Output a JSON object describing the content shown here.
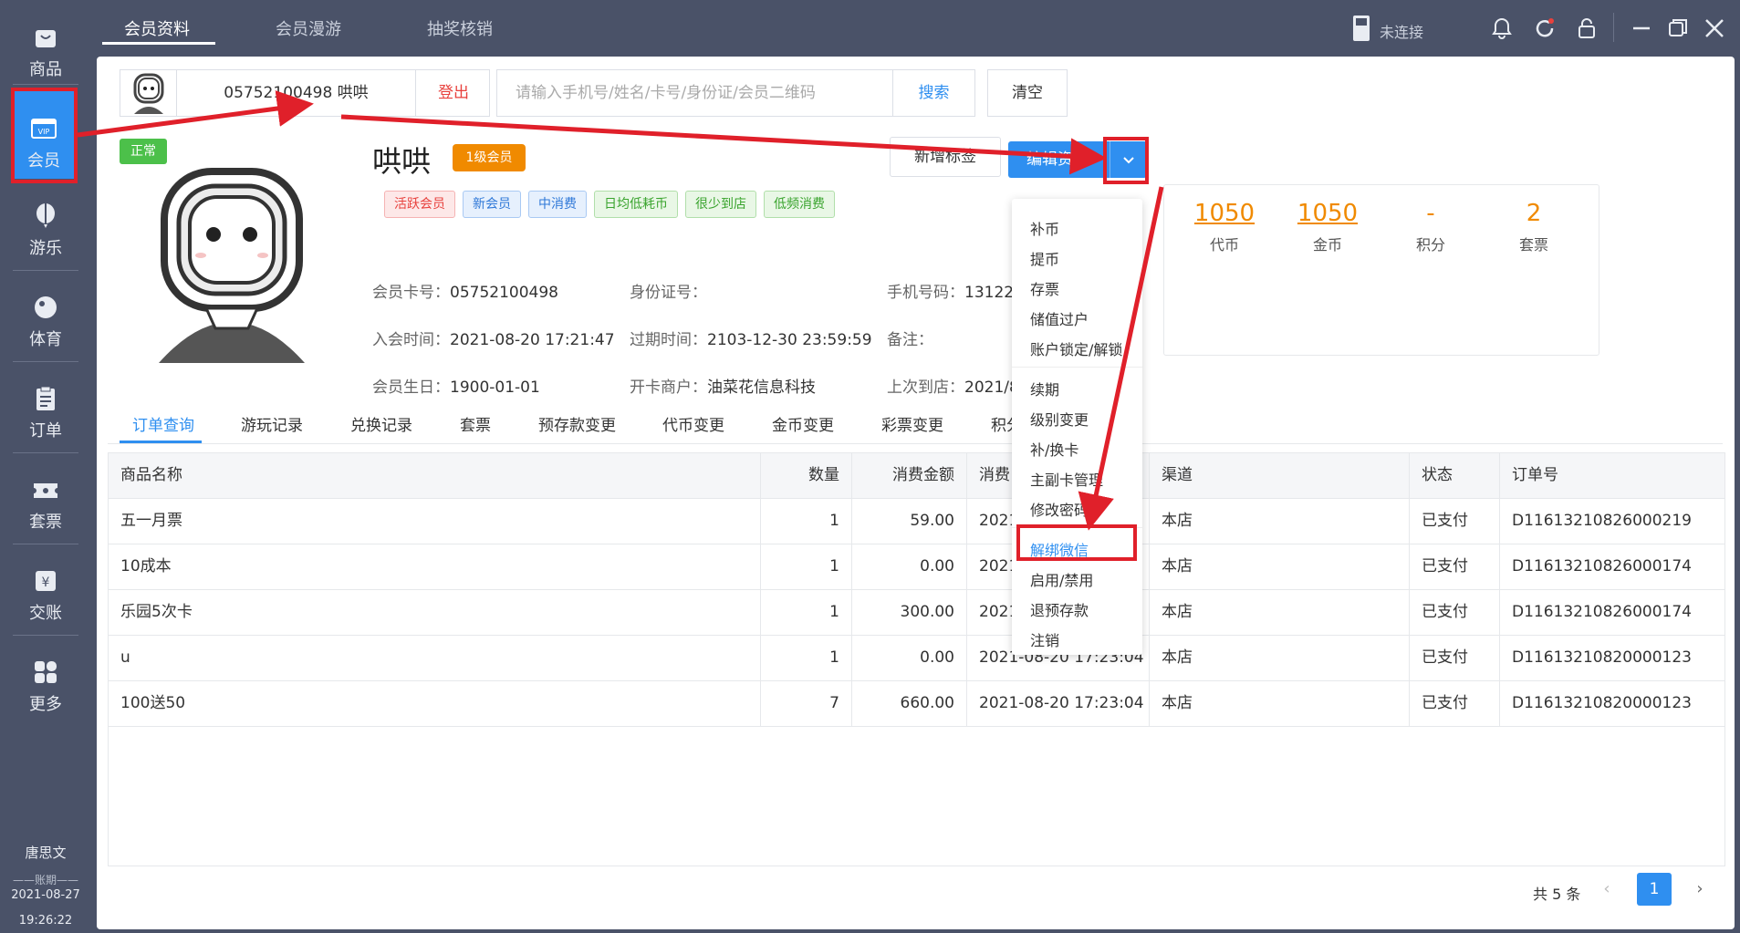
{
  "colors": {
    "sidebar": "#4a5268",
    "accent": "#2f8ff0",
    "orange": "#f08a00",
    "danger": "#e8413d",
    "annotation": "#e0202a"
  },
  "sidebar": {
    "items": [
      {
        "label": "商品",
        "icon": "bag-icon"
      },
      {
        "label": "会员",
        "icon": "vip-card-icon"
      },
      {
        "label": "游乐",
        "icon": "balloon-icon"
      },
      {
        "label": "体育",
        "icon": "ball-icon"
      },
      {
        "label": "订单",
        "icon": "clipboard-icon"
      },
      {
        "label": "套票",
        "icon": "ticket-icon"
      },
      {
        "label": "交账",
        "icon": "yen-icon"
      },
      {
        "label": "更多",
        "icon": "grid-icon"
      }
    ],
    "user": "唐思文",
    "period_label": "账期",
    "date": "2021-08-27",
    "time": "19:26:22"
  },
  "topbar": {
    "tabs": [
      "会员资料",
      "会员漫游",
      "抽奖核销"
    ],
    "device_status": "未连接"
  },
  "search": {
    "member_id": "05752100498  哄哄",
    "logout": "登出",
    "placeholder": "请输入手机号/姓名/卡号/身份证/会员二维码",
    "search_btn": "搜索",
    "clear_btn": "清空"
  },
  "profile": {
    "status": "正常",
    "name": "哄哄",
    "level": "1级会员",
    "tags": [
      "活跃会员",
      "新会员",
      "中消费",
      "日均低耗币",
      "很少到店",
      "低频消费"
    ],
    "fields": {
      "card_label": "会员卡号：",
      "card": "05752100498",
      "idcard_label": "身份证号：",
      "idcard": "",
      "phone_label": "手机号码：",
      "phone": "13122",
      "join_label": "入会时间：",
      "join": "2021-08-20 17:21:47",
      "expire_label": "过期时间：",
      "expire": "2103-12-30 23:59:59",
      "remark_label": "备注：",
      "remark": "",
      "birthday_label": "会员生日：",
      "birthday": "1900-01-01",
      "merchant_label": "开卡商户：",
      "merchant": "油菜花信息科技",
      "last_visit_label": "上次到店：",
      "last_visit": "2021/8"
    },
    "add_tag_btn": "新增标签",
    "edit_btn": "编辑资料"
  },
  "stats": [
    {
      "value": "1050",
      "label": "代币"
    },
    {
      "value": "1050",
      "label": "金币"
    },
    {
      "value": "-",
      "label": "积分"
    },
    {
      "value": "2",
      "label": "套票"
    }
  ],
  "dropdown": {
    "group1": [
      "补币",
      "提币",
      "存票",
      "储值过户",
      "账户锁定/解锁"
    ],
    "group2": [
      "续期",
      "级别变更",
      "补/换卡",
      "主副卡管理",
      "修改密码"
    ],
    "group3": [
      "解绑微信",
      "启用/禁用",
      "退预存款",
      "注销"
    ]
  },
  "subtabs": [
    "订单查询",
    "游玩记录",
    "兑换记录",
    "套票",
    "预存款变更",
    "代币变更",
    "金币变更",
    "彩票变更",
    "积分"
  ],
  "table": {
    "headers": [
      "商品名称",
      "数量",
      "消费金额",
      "消费",
      "渠道",
      "状态",
      "订单号"
    ],
    "rows": [
      [
        "五一月票",
        "1",
        "59.00",
        "2021",
        "本店",
        "已支付",
        "D11613210826000219"
      ],
      [
        "10成本",
        "1",
        "0.00",
        "2021",
        "本店",
        "已支付",
        "D11613210826000174"
      ],
      [
        "乐园5次卡",
        "1",
        "300.00",
        "2021",
        "本店",
        "已支付",
        "D11613210826000174"
      ],
      [
        "u",
        "1",
        "0.00",
        "2021-08-20 17:23:04",
        "本店",
        "已支付",
        "D11613210820000123"
      ],
      [
        "100送50",
        "7",
        "660.00",
        "2021-08-20 17:23:04",
        "本店",
        "已支付",
        "D11613210820000123"
      ]
    ]
  },
  "pagination": {
    "total": "共 5 条",
    "current": "1",
    "prev": "‹",
    "next": "›"
  }
}
